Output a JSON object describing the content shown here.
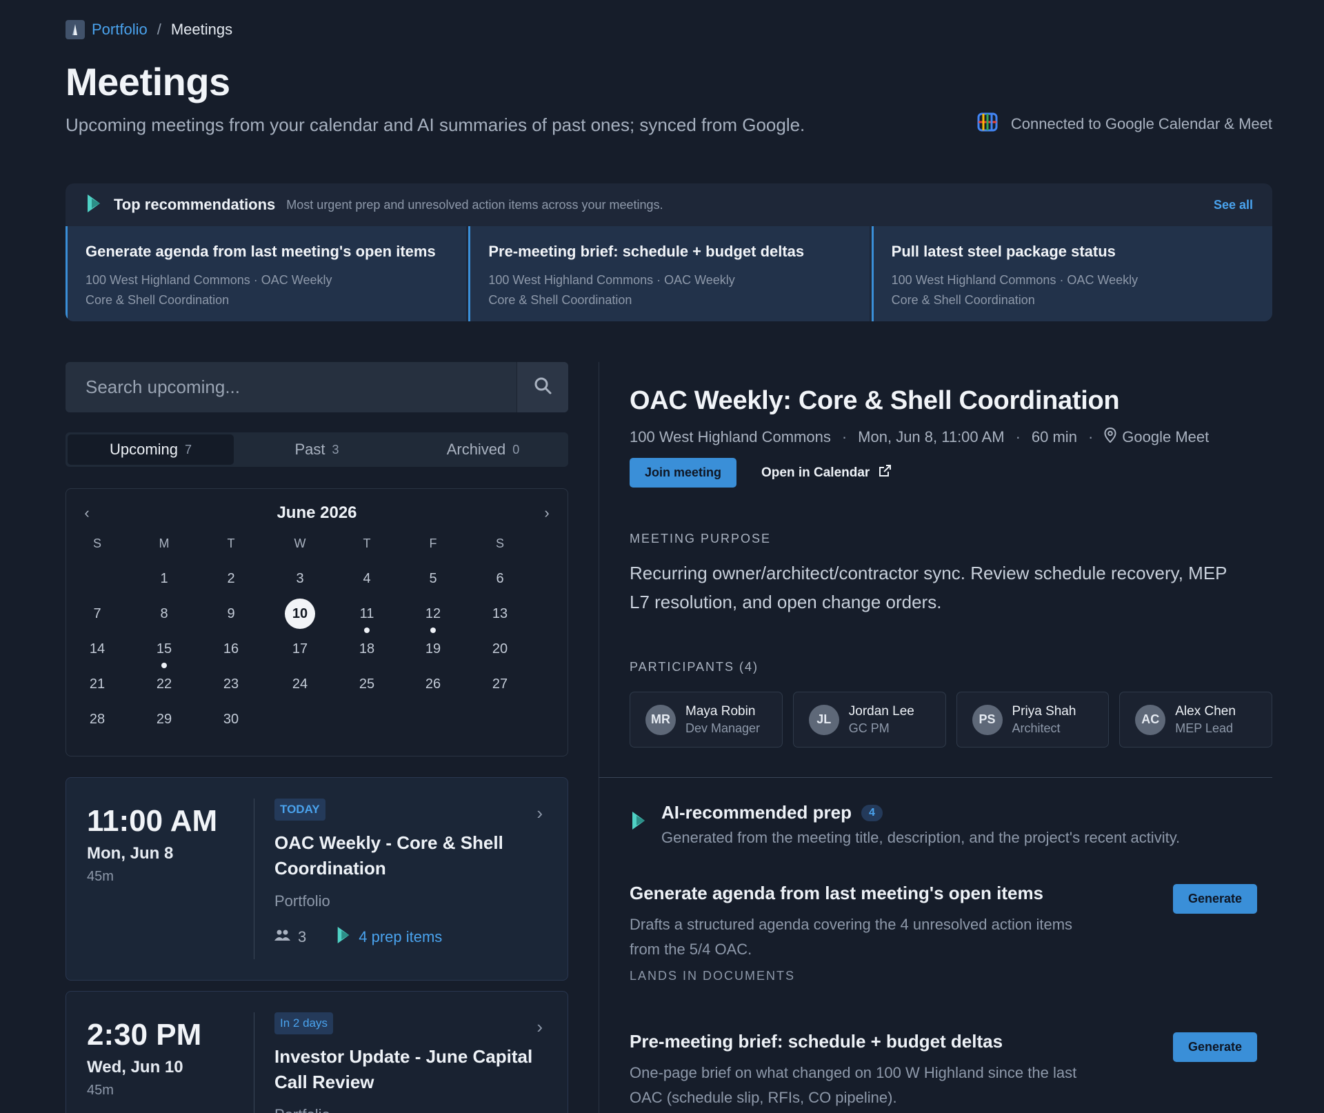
{
  "breadcrumb": {
    "parent": "Portfolio",
    "separator": "/",
    "current": "Meetings"
  },
  "header": {
    "title": "Meetings",
    "subtitle": "Upcoming meetings from your calendar and AI summaries of past ones; synced from Google.",
    "connection": "Connected to Google Calendar & Meet"
  },
  "recommendations": {
    "title": "Top recommendations",
    "subtitle": "Most urgent prep and unresolved action items across your meetings.",
    "see_all": "See all",
    "cards": [
      {
        "title": "Generate agenda from last meeting's open items",
        "line1": "100 West Highland Commons · OAC Weekly",
        "line2": "Core & Shell Coordination"
      },
      {
        "title": "Pre-meeting brief: schedule + budget deltas",
        "line1": "100 West Highland Commons · OAC Weekly",
        "line2": "Core & Shell Coordination"
      },
      {
        "title": "Pull latest steel package status",
        "line1": "100 West Highland Commons · OAC Weekly",
        "line2": "Core & Shell Coordination"
      }
    ]
  },
  "search": {
    "placeholder": "Search upcoming..."
  },
  "tabs": [
    {
      "label": "Upcoming",
      "count": "7"
    },
    {
      "label": "Past",
      "count": "3"
    },
    {
      "label": "Archived",
      "count": "0"
    }
  ],
  "calendar": {
    "month": "June 2026",
    "weekdays": [
      "S",
      "M",
      "T",
      "W",
      "T",
      "F",
      "S"
    ],
    "weeks": [
      [
        "",
        "1",
        "2",
        "3",
        "4",
        "5",
        "6"
      ],
      [
        "7",
        "8",
        "9",
        "10",
        "11",
        "12",
        "13"
      ],
      [
        "14",
        "15",
        "16",
        "17",
        "18",
        "19",
        "20"
      ],
      [
        "21",
        "22",
        "23",
        "24",
        "25",
        "26",
        "27"
      ],
      [
        "28",
        "29",
        "30",
        "",
        "",
        "",
        ""
      ]
    ],
    "selected": "10",
    "event_days": [
      "11",
      "12",
      "15"
    ]
  },
  "meetings": [
    {
      "time": "11:00 AM",
      "date": "Mon, Jun 8",
      "duration": "45m",
      "badge": "TODAY",
      "title": "OAC Weekly - Core & Shell Coordination",
      "project": "Portfolio",
      "attendees": "3",
      "prep": "4 prep items"
    },
    {
      "time": "2:30 PM",
      "date": "Wed, Jun 10",
      "duration": "45m",
      "badge": "In 2 days",
      "title": "Investor Update - June Capital Call Review",
      "project": "Portfolio"
    }
  ],
  "detail": {
    "title": "OAC Weekly: Core & Shell Coordination",
    "project": "100 West Highland Commons",
    "datetime": "Mon, Jun 8, 11:00 AM",
    "duration": "60 min",
    "location": "Google Meet",
    "join_label": "Join meeting",
    "calendar_label": "Open in Calendar",
    "purpose_label": "MEETING PURPOSE",
    "purpose": "Recurring owner/architect/contractor sync. Review schedule recovery, MEP L7 resolution, and open change orders.",
    "participants_label": "PARTICIPANTS (4)",
    "participants": [
      {
        "initials": "MR",
        "name": "Maya Robin",
        "role": "Dev Manager"
      },
      {
        "initials": "JL",
        "name": "Jordan Lee",
        "role": "GC PM"
      },
      {
        "initials": "PS",
        "name": "Priya Shah",
        "role": "Architect"
      },
      {
        "initials": "AC",
        "name": "Alex Chen",
        "role": "MEP Lead"
      }
    ],
    "ai_prep": {
      "title": "AI-recommended prep",
      "count": "4",
      "subtitle": "Generated from the meeting title, description, and the project's recent activity.",
      "items": [
        {
          "title": "Generate agenda from last meeting's open items",
          "desc": "Drafts a structured agenda covering the 4 unresolved action items from the 5/4 OAC.",
          "lands": "LANDS IN DOCUMENTS",
          "button": "Generate"
        },
        {
          "title": "Pre-meeting brief: schedule + budget deltas",
          "desc": "One-page brief on what changed on 100 W Highland since the last OAC (schedule slip, RFIs, CO pipeline).",
          "button": "Generate"
        }
      ]
    }
  },
  "colors": {
    "background": "#161d2a",
    "accent": "#3a8fd8",
    "link": "#4aa3ee",
    "ai_icon": "#4fd1c5"
  },
  "icons": [
    "app-logo-icon",
    "google-calendar-icon",
    "sparkle-icon",
    "search-icon",
    "chevron-left-icon",
    "chevron-right-icon",
    "people-icon",
    "location-pin-icon",
    "external-link-icon"
  ]
}
